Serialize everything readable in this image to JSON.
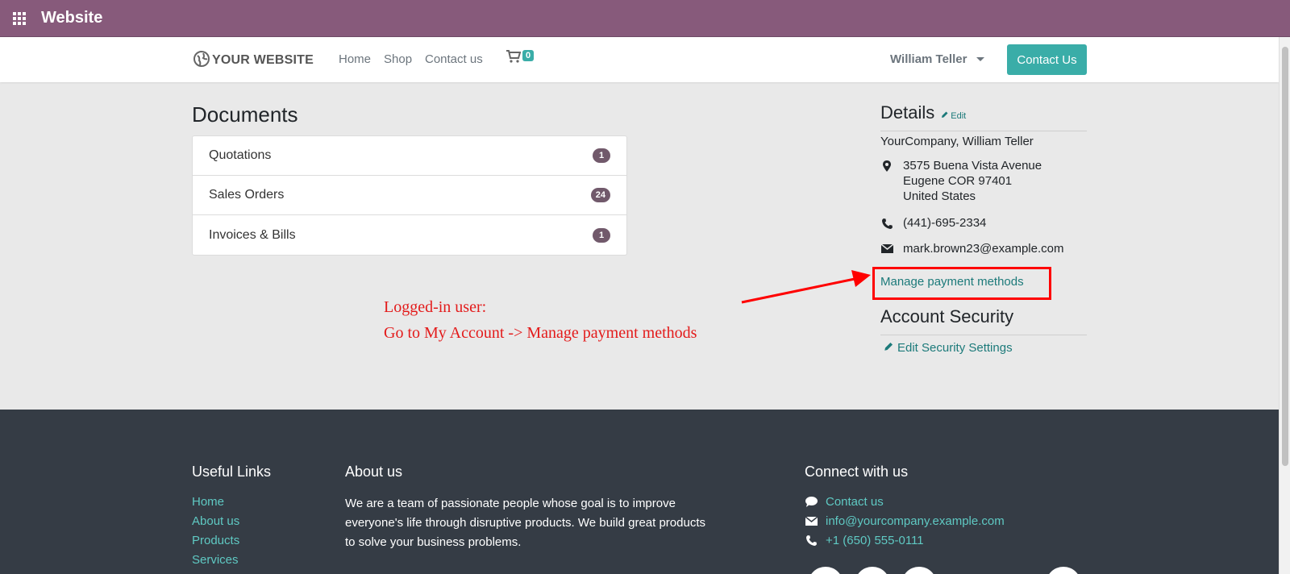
{
  "appbar": {
    "title": "Website"
  },
  "navbar": {
    "logo_text": "YOUR WEBSITE",
    "links": [
      "Home",
      "Shop",
      "Contact us"
    ],
    "cart_count": "0",
    "user_name": "William Teller",
    "contact_button": "Contact Us"
  },
  "documents": {
    "title": "Documents",
    "items": [
      {
        "label": "Quotations",
        "count": "1"
      },
      {
        "label": "Sales Orders",
        "count": "24"
      },
      {
        "label": "Invoices & Bills",
        "count": "1"
      }
    ]
  },
  "details": {
    "title": "Details",
    "edit_label": "Edit",
    "company": "YourCompany, William Teller",
    "address": [
      "3575 Buena Vista Avenue",
      "Eugene COR 97401",
      "United States"
    ],
    "phone": "(441)-695-2334",
    "email": "mark.brown23@example.com",
    "manage_payment": "Manage payment methods"
  },
  "account_security": {
    "title": "Account Security",
    "edit_settings": "Edit Security Settings"
  },
  "annotation": {
    "line1": "Logged-in user:",
    "line2": "Go to My Account -> Manage payment methods",
    "color": "#e31b1b"
  },
  "footer": {
    "useful_links_title": "Useful Links",
    "useful_links": [
      "Home",
      "About us",
      "Products",
      "Services"
    ],
    "about_title": "About us",
    "about_text": "We are a team of passionate people whose goal is to improve everyone's life through disruptive products. We build great products to solve your business problems.",
    "connect_title": "Connect with us",
    "contact_link": "Contact us",
    "email": "info@yourcompany.example.com",
    "phone": "+1 (650) 555-0111"
  },
  "colors": {
    "brand": "#875a7b",
    "accent": "#3aada8",
    "link": "#1c7a7a",
    "footer_bg": "#353c45"
  }
}
